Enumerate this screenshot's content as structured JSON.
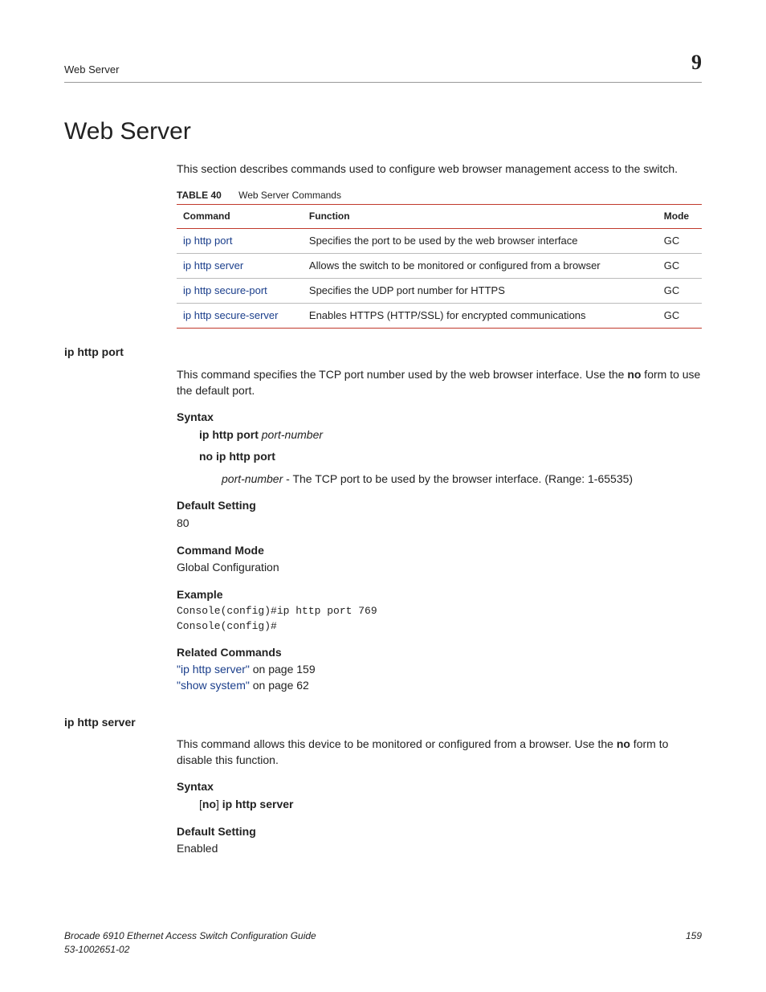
{
  "header": {
    "running_title": "Web Server",
    "chapter_number": "9"
  },
  "title": "Web Server",
  "intro": "This section describes commands used to configure web browser management access to the switch.",
  "table": {
    "label": "TABLE 40",
    "caption": "Web Server Commands",
    "headers": {
      "col1": "Command",
      "col2": "Function",
      "col3": "Mode"
    },
    "rows": [
      {
        "cmd": "ip http port",
        "func": "Specifies the port to be used by the web browser interface",
        "mode": "GC"
      },
      {
        "cmd": "ip http server",
        "func": "Allows the switch to be monitored or configured from a browser",
        "mode": "GC"
      },
      {
        "cmd": "ip http secure-port",
        "func": "Specifies the UDP port number for HTTPS",
        "mode": "GC"
      },
      {
        "cmd": "ip http secure-server",
        "func": "Enables HTTPS (HTTP/SSL) for encrypted communications",
        "mode": "GC"
      }
    ]
  },
  "sec1": {
    "heading": "ip http port",
    "desc_pre": "This command specifies the TCP port number used by the web browser interface. Use the ",
    "desc_bold": "no",
    "desc_post": " form to use the default port.",
    "syntax_label": "Syntax",
    "syntax_line1_cmd": "ip http port",
    "syntax_line1_arg": " port-number",
    "syntax_line2": "no ip http port",
    "param_name": "port-number",
    "param_desc": " - The TCP port to be used by the browser interface. (Range: 1-65535)",
    "default_label": "Default Setting",
    "default_value": "80",
    "mode_label": "Command Mode",
    "mode_value": "Global Configuration",
    "example_label": "Example",
    "example_code": "Console(config)#ip http port 769\nConsole(config)#",
    "related_label": "Related Commands",
    "related_1_link": "\"ip http server\"",
    "related_1_rest": " on page 159",
    "related_2_link": "\"show system\"",
    "related_2_rest": " on page 62"
  },
  "sec2": {
    "heading": "ip http server",
    "desc_pre": "This command allows this device to be monitored or configured from a browser. Use the ",
    "desc_bold": "no",
    "desc_post": " form to disable this function.",
    "syntax_label": "Syntax",
    "syntax_open": "[",
    "syntax_no": "no",
    "syntax_close": "] ",
    "syntax_cmd": "ip http server",
    "default_label": "Default Setting",
    "default_value": "Enabled"
  },
  "footer": {
    "line1": "Brocade 6910 Ethernet Access Switch Configuration Guide",
    "line2": "53-1002651-02",
    "page": "159"
  }
}
